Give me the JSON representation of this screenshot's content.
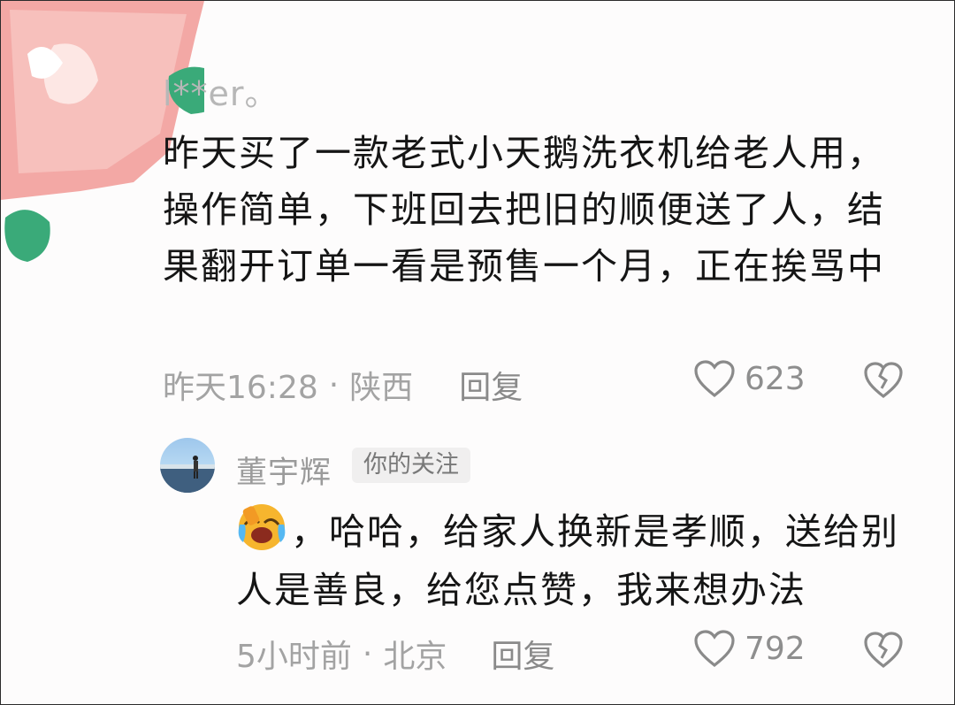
{
  "comment": {
    "username": "l**er。",
    "text": "昨天买了一款老式小天鹅洗衣机给老人用，操作简单，下班回去把旧的顺便送了人，结果翻开订单一看是预售一个月，正在挨骂中",
    "time": "昨天16:28",
    "location": "陕西",
    "reply_label": "回复",
    "likes": "623"
  },
  "reply": {
    "username": "董宇辉",
    "badge": "你的关注",
    "text": "，哈哈，给家人换新是孝顺，送给别人是善良，给您点赞，我来想办法",
    "emoji_icon": "laughing-crying-emoji-icon",
    "time": "5小时前",
    "location": "北京",
    "reply_label": "回复",
    "likes": "792"
  },
  "colors": {
    "meta_text": "#a3a3a3",
    "badge_bg": "#f0efef",
    "avatar_pink": "#f0a5a5",
    "avatar_green": "#3fae7a"
  },
  "separator": "·"
}
